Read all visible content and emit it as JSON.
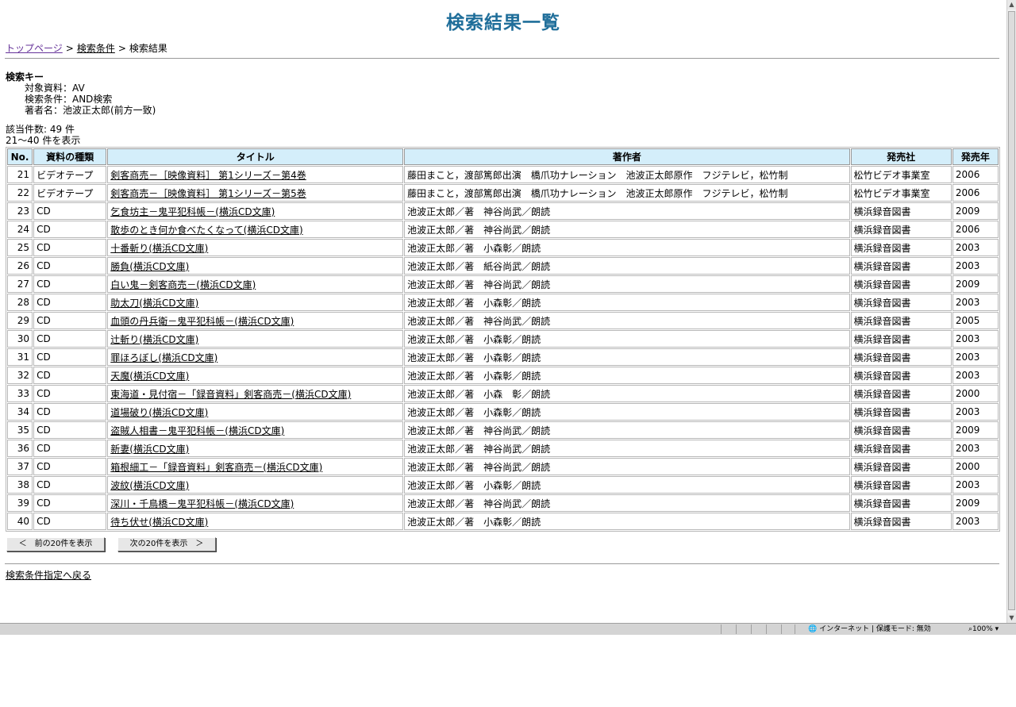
{
  "page": {
    "title": "検索結果一覧",
    "breadcrumb": {
      "top": "トップページ",
      "sep": ">",
      "cond": "検索条件",
      "current": "検索結果"
    },
    "search_key": {
      "heading": "検索キー",
      "target": "対象資料：AV",
      "condition": "検索条件：AND検索",
      "author": "著者名：池波正太郎(前方一致)"
    },
    "counts": {
      "total": "該当件数: 49 件",
      "range": "21～40 件を表示"
    },
    "table": {
      "headers": [
        "No.",
        "資料の種類",
        "タイトル",
        "著作者",
        "発売社",
        "発売年"
      ],
      "rows": [
        {
          "no": "21",
          "type": "ビデオテープ",
          "title": "剣客商売－［映像資料］ 第1シリーズ－第4巻",
          "author": "藤田まこと，渡部篤郎出演　橋爪功ナレーション　池波正太郎原作　フジテレビ，松竹制",
          "publisher": "松竹ビデオ事業室",
          "year": "2006"
        },
        {
          "no": "22",
          "type": "ビデオテープ",
          "title": "剣客商売－［映像資料］ 第1シリーズ－第5巻",
          "author": "藤田まこと，渡部篤郎出演　橋爪功ナレーション　池波正太郎原作　フジテレビ，松竹制",
          "publisher": "松竹ビデオ事業室",
          "year": "2006"
        },
        {
          "no": "23",
          "type": "CD",
          "title": "乞食坊主－鬼平犯科帳－(横浜CD文庫)",
          "author": "池波正太郎／著　神谷尚武／朗読",
          "publisher": "横浜録音図書",
          "year": "2009"
        },
        {
          "no": "24",
          "type": "CD",
          "title": "散歩のとき何か食べたくなって(横浜CD文庫)",
          "author": "池波正太郎／著　神谷尚武／朗読",
          "publisher": "横浜録音図書",
          "year": "2006"
        },
        {
          "no": "25",
          "type": "CD",
          "title": "十番斬り(横浜CD文庫)",
          "author": "池波正太郎／著　小森彰／朗読",
          "publisher": "横浜録音図書",
          "year": "2003"
        },
        {
          "no": "26",
          "type": "CD",
          "title": "勝負(横浜CD文庫)",
          "author": "池波正太郎／著　紙谷尚武／朗読",
          "publisher": "横浜録音図書",
          "year": "2003"
        },
        {
          "no": "27",
          "type": "CD",
          "title": "白い鬼－剣客商売－(横浜CD文庫)",
          "author": "池波正太郎／著　神谷尚武／朗読",
          "publisher": "横浜録音図書",
          "year": "2009"
        },
        {
          "no": "28",
          "type": "CD",
          "title": "助太刀(横浜CD文庫)",
          "author": "池波正太郎／著　小森彰／朗読",
          "publisher": "横浜録音図書",
          "year": "2003"
        },
        {
          "no": "29",
          "type": "CD",
          "title": "血頭の丹兵衛－鬼平犯科帳－(横浜CD文庫)",
          "author": "池波正太郎／著　神谷尚武／朗読",
          "publisher": "横浜録音図書",
          "year": "2005"
        },
        {
          "no": "30",
          "type": "CD",
          "title": "辻斬り(横浜CD文庫)",
          "author": "池波正太郎／著　小森彰／朗読",
          "publisher": "横浜録音図書",
          "year": "2003"
        },
        {
          "no": "31",
          "type": "CD",
          "title": "罪ほろぼし(横浜CD文庫)",
          "author": "池波正太郎／著　小森彰／朗読",
          "publisher": "横浜録音図書",
          "year": "2003"
        },
        {
          "no": "32",
          "type": "CD",
          "title": "天魔(横浜CD文庫)",
          "author": "池波正太郎／著　小森彰／朗読",
          "publisher": "横浜録音図書",
          "year": "2003"
        },
        {
          "no": "33",
          "type": "CD",
          "title": "東海道・見付宿－「録音資料」剣客商売－(横浜CD文庫)",
          "author": "池波正太郎／著　小森　彰／朗読",
          "publisher": "横浜録音図書",
          "year": "2000"
        },
        {
          "no": "34",
          "type": "CD",
          "title": "道場破り(横浜CD文庫)",
          "author": "池波正太郎／著　小森彰／朗読",
          "publisher": "横浜録音図書",
          "year": "2003"
        },
        {
          "no": "35",
          "type": "CD",
          "title": "盗賊人相書－鬼平犯科帳－(横浜CD文庫)",
          "author": "池波正太郎／著　神谷尚武／朗読",
          "publisher": "横浜録音図書",
          "year": "2009"
        },
        {
          "no": "36",
          "type": "CD",
          "title": "新妻(横浜CD文庫)",
          "author": "池波正太郎／著　神谷尚武／朗読",
          "publisher": "横浜録音図書",
          "year": "2003"
        },
        {
          "no": "37",
          "type": "CD",
          "title": "箱根細工－「録音資料」剣客商売－(横浜CD文庫)",
          "author": "池波正太郎／著　神谷尚武／朗読",
          "publisher": "横浜録音図書",
          "year": "2000"
        },
        {
          "no": "38",
          "type": "CD",
          "title": "波紋(横浜CD文庫)",
          "author": "池波正太郎／著　小森彰／朗読",
          "publisher": "横浜録音図書",
          "year": "2003"
        },
        {
          "no": "39",
          "type": "CD",
          "title": "深川・千鳥橋－鬼平犯科帳－(横浜CD文庫)",
          "author": "池波正太郎／著　神谷尚武／朗読",
          "publisher": "横浜録音図書",
          "year": "2009"
        },
        {
          "no": "40",
          "type": "CD",
          "title": "待ち伏せ(横浜CD文庫)",
          "author": "池波正太郎／著　小森彰／朗読",
          "publisher": "横浜録音図書",
          "year": "2003"
        }
      ]
    },
    "buttons": {
      "prev": "＜　前の20件を表示",
      "next": "次の20件を表示　＞"
    },
    "back_link": "検索条件指定へ戻る"
  },
  "statusbar": {
    "zone": "インターネット | 保護モード: 無効",
    "zoom": "100%"
  },
  "colors": {
    "title": "#1f6e9a",
    "header_bg": "#d4eefa"
  }
}
